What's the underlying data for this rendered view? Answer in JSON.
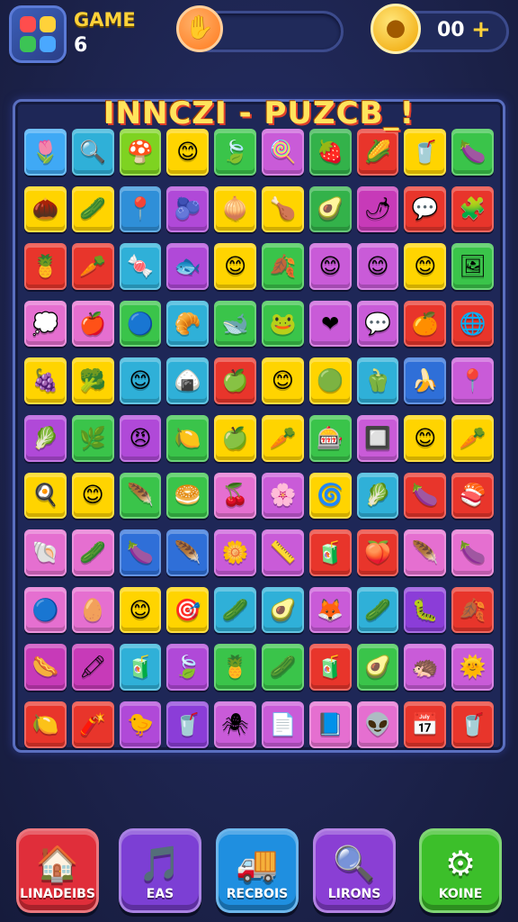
{
  "header": {
    "title": "GAME",
    "level": "6",
    "energy_value": "",
    "coins": "00",
    "coin_plus": "+"
  },
  "board": {
    "title": "INNCZI - PUZCB_!"
  },
  "tiles": [
    {
      "color": "#3fa9f5",
      "icon": "🌷"
    },
    {
      "color": "#2fb0d8",
      "icon": "🔍"
    },
    {
      "color": "#7ed321",
      "icon": "🍄"
    },
    {
      "color": "#ffd400",
      "icon": "😊"
    },
    {
      "color": "#3ac44a",
      "icon": "🍃"
    },
    {
      "color": "#c95bd8",
      "icon": "🍭"
    },
    {
      "color": "#33b24a",
      "icon": "🍓"
    },
    {
      "color": "#e8352b",
      "icon": "🌽"
    },
    {
      "color": "#ffd400",
      "icon": "🥤"
    },
    {
      "color": "#3ac44a",
      "icon": "🍆"
    },
    {
      "color": "#ffd400",
      "icon": "🌰"
    },
    {
      "color": "#ffd400",
      "icon": "🥒"
    },
    {
      "color": "#2f8fd8",
      "icon": "📍"
    },
    {
      "color": "#b049d8",
      "icon": "🫐"
    },
    {
      "color": "#ffd400",
      "icon": "🧅"
    },
    {
      "color": "#ffd400",
      "icon": "🍗"
    },
    {
      "color": "#33b24a",
      "icon": "🥑"
    },
    {
      "color": "#c73ab8",
      "icon": "🌶"
    },
    {
      "color": "#e8352b",
      "icon": "💬"
    },
    {
      "color": "#e8352b",
      "icon": "🧩"
    },
    {
      "color": "#e8352b",
      "icon": "🍍"
    },
    {
      "color": "#e8352b",
      "icon": "🥕"
    },
    {
      "color": "#2fb0d8",
      "icon": "🍬"
    },
    {
      "color": "#b049d8",
      "icon": "🐟"
    },
    {
      "color": "#ffd400",
      "icon": "😊"
    },
    {
      "color": "#3ac44a",
      "icon": "🍂"
    },
    {
      "color": "#c95bd8",
      "icon": "😊"
    },
    {
      "color": "#c95bd8",
      "icon": "😊"
    },
    {
      "color": "#ffd400",
      "icon": "😊"
    },
    {
      "color": "#3ac44a",
      "icon": "🖼"
    },
    {
      "color": "#e56fd0",
      "icon": "💭"
    },
    {
      "color": "#e56fd0",
      "icon": "🍎"
    },
    {
      "color": "#3ac44a",
      "icon": "🔵"
    },
    {
      "color": "#2fb0d8",
      "icon": "🥐"
    },
    {
      "color": "#3ac44a",
      "icon": "🐋"
    },
    {
      "color": "#3ac44a",
      "icon": "🐸"
    },
    {
      "color": "#c95bd8",
      "icon": "❤"
    },
    {
      "color": "#c95bd8",
      "icon": "💬"
    },
    {
      "color": "#e8352b",
      "icon": "🍊"
    },
    {
      "color": "#e8352b",
      "icon": "🌐"
    },
    {
      "color": "#ffd400",
      "icon": "🍇"
    },
    {
      "color": "#ffd400",
      "icon": "🥦"
    },
    {
      "color": "#2fb0d8",
      "icon": "😊"
    },
    {
      "color": "#2fb0d8",
      "icon": "🍙"
    },
    {
      "color": "#e8352b",
      "icon": "🍏"
    },
    {
      "color": "#ffd400",
      "icon": "😊"
    },
    {
      "color": "#ffd400",
      "icon": "🟢"
    },
    {
      "color": "#2fb0d8",
      "icon": "🫑"
    },
    {
      "color": "#2f6fd8",
      "icon": "🍌"
    },
    {
      "color": "#c95bd8",
      "icon": "📍"
    },
    {
      "color": "#b049d8",
      "icon": "🥬"
    },
    {
      "color": "#3ac44a",
      "icon": "🌿"
    },
    {
      "color": "#b049d8",
      "icon": "😠"
    },
    {
      "color": "#3ac44a",
      "icon": "🍋"
    },
    {
      "color": "#ffd400",
      "icon": "🍏"
    },
    {
      "color": "#ffd400",
      "icon": "🥕"
    },
    {
      "color": "#3ac44a",
      "icon": "🎰"
    },
    {
      "color": "#c95bd8",
      "icon": "🔲"
    },
    {
      "color": "#ffd400",
      "icon": "😊"
    },
    {
      "color": "#ffd400",
      "icon": "🥕"
    },
    {
      "color": "#ffd400",
      "icon": "🍳"
    },
    {
      "color": "#ffd400",
      "icon": "😊"
    },
    {
      "color": "#3ac44a",
      "icon": "🪶"
    },
    {
      "color": "#3ac44a",
      "icon": "🥯"
    },
    {
      "color": "#e56fd0",
      "icon": "🍒"
    },
    {
      "color": "#c95bd8",
      "icon": "🌸"
    },
    {
      "color": "#ffd400",
      "icon": "🌀"
    },
    {
      "color": "#2fb0d8",
      "icon": "🥬"
    },
    {
      "color": "#e8352b",
      "icon": "🍆"
    },
    {
      "color": "#e8352b",
      "icon": "🍣"
    },
    {
      "color": "#e56fd0",
      "icon": "🐚"
    },
    {
      "color": "#e56fd0",
      "icon": "🥒"
    },
    {
      "color": "#2f6fd8",
      "icon": "🍆"
    },
    {
      "color": "#2f6fd8",
      "icon": "🪶"
    },
    {
      "color": "#c95bd8",
      "icon": "🌼"
    },
    {
      "color": "#c95bd8",
      "icon": "📏"
    },
    {
      "color": "#e8352b",
      "icon": "🧃"
    },
    {
      "color": "#e8352b",
      "icon": "🍑"
    },
    {
      "color": "#e56fd0",
      "icon": "🪶"
    },
    {
      "color": "#e56fd0",
      "icon": "🍆"
    },
    {
      "color": "#e56fd0",
      "icon": "🔵"
    },
    {
      "color": "#e56fd0",
      "icon": "🥚"
    },
    {
      "color": "#ffd400",
      "icon": "😊"
    },
    {
      "color": "#ffd400",
      "icon": "🎯"
    },
    {
      "color": "#2fb0d8",
      "icon": "🥒"
    },
    {
      "color": "#2fb0d8",
      "icon": "🥑"
    },
    {
      "color": "#c95bd8",
      "icon": "🦊"
    },
    {
      "color": "#2fb0d8",
      "icon": "🥒"
    },
    {
      "color": "#8b3dd8",
      "icon": "🐛"
    },
    {
      "color": "#e8352b",
      "icon": "🍂"
    },
    {
      "color": "#c73ab8",
      "icon": "🌭"
    },
    {
      "color": "#c73ab8",
      "icon": "🖍"
    },
    {
      "color": "#2fb0d8",
      "icon": "🧃"
    },
    {
      "color": "#b049d8",
      "icon": "🍃"
    },
    {
      "color": "#3ac44a",
      "icon": "🍍"
    },
    {
      "color": "#3ac44a",
      "icon": "🥒"
    },
    {
      "color": "#e8352b",
      "icon": "🧃"
    },
    {
      "color": "#3ac44a",
      "icon": "🥑"
    },
    {
      "color": "#c95bd8",
      "icon": "🦔"
    },
    {
      "color": "#c95bd8",
      "icon": "🌞"
    },
    {
      "color": "#e8352b",
      "icon": "🍋"
    },
    {
      "color": "#e8352b",
      "icon": "🧨"
    },
    {
      "color": "#b049d8",
      "icon": "🐤"
    },
    {
      "color": "#8b3dd8",
      "icon": "🥤"
    },
    {
      "color": "#c95bd8",
      "icon": "🕷"
    },
    {
      "color": "#c95bd8",
      "icon": "📄"
    },
    {
      "color": "#e56fd0",
      "icon": "📘"
    },
    {
      "color": "#e56fd0",
      "icon": "👽"
    },
    {
      "color": "#e8352b",
      "icon": "📅"
    },
    {
      "color": "#e8352b",
      "icon": "🥤"
    }
  ],
  "nav": [
    {
      "label": "LINADEIBS",
      "icon": "🏠",
      "color": "#e02e3a",
      "name": "home"
    },
    {
      "label": "EAS",
      "icon": "🎵",
      "color": "#7c3fd4",
      "name": "music"
    },
    {
      "label": "RECBOIS",
      "icon": "🚚",
      "color": "#1f8fe0",
      "name": "records"
    },
    {
      "label": "LIRONS",
      "icon": "🔍",
      "color": "#8a3fd4",
      "name": "search"
    },
    {
      "label": "KOINE",
      "icon": "⚙",
      "color": "#3cbf2a",
      "name": "settings"
    }
  ]
}
